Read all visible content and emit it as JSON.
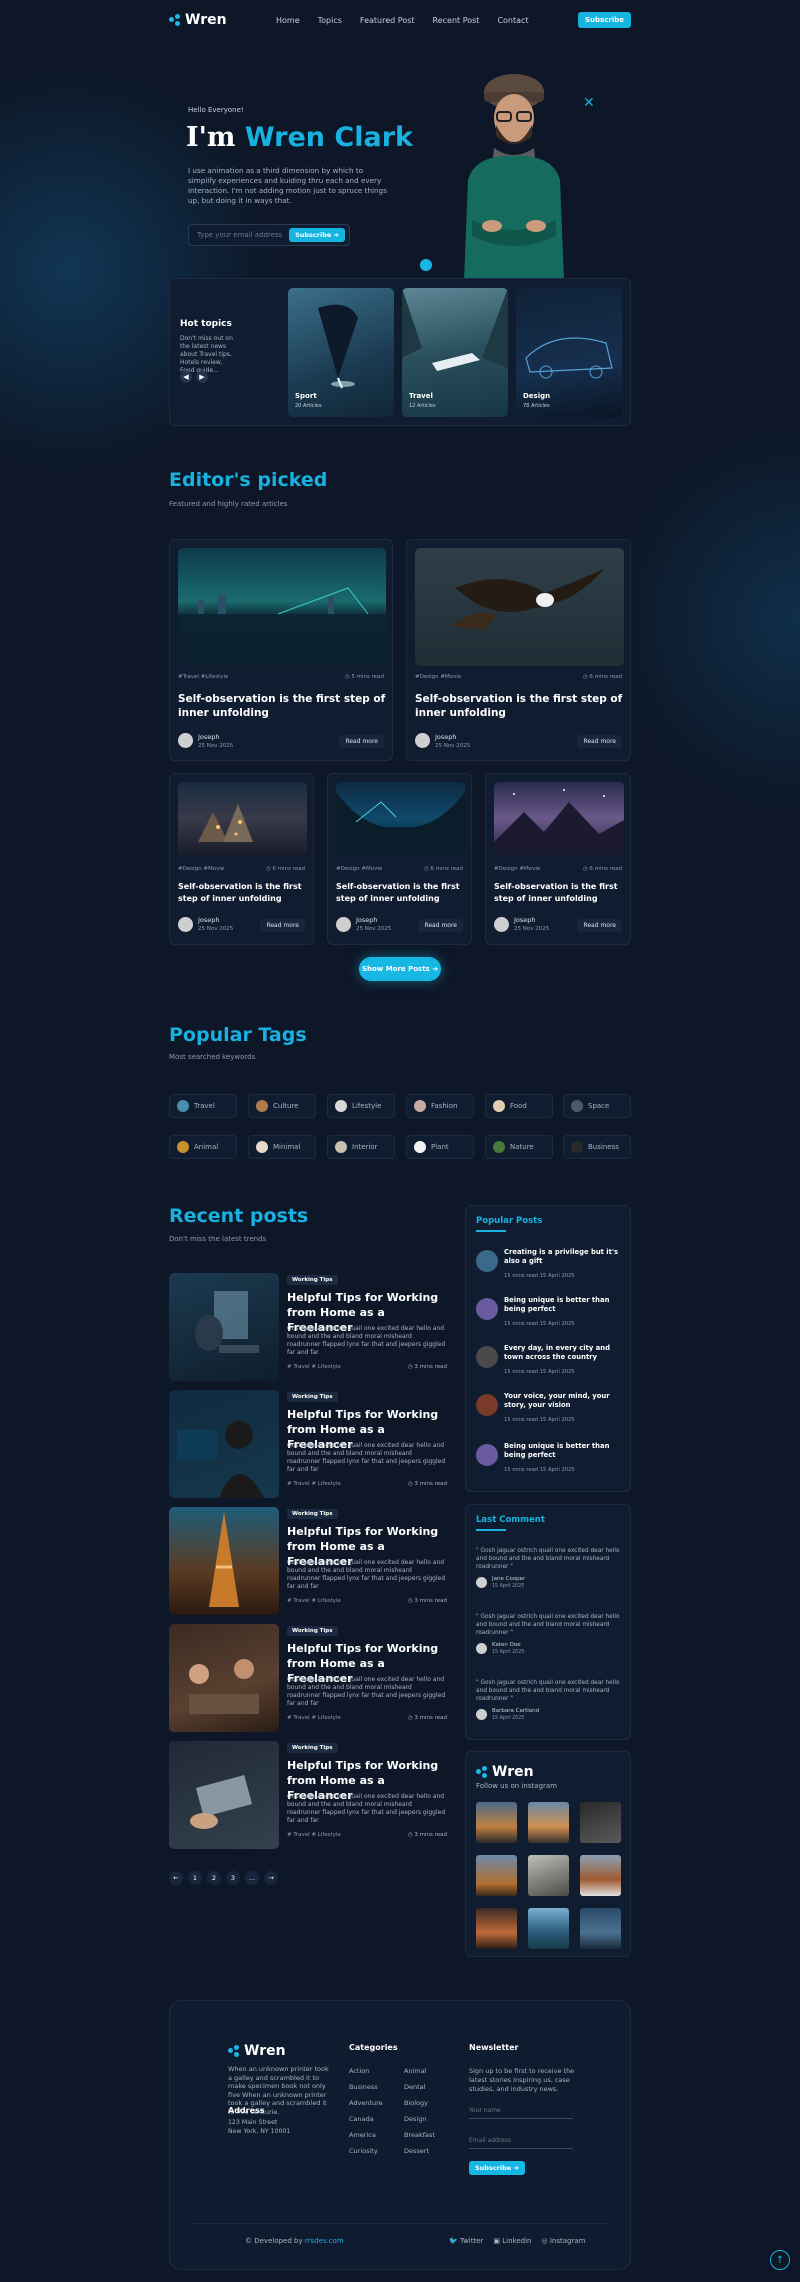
{
  "nav": {
    "brand": "Wren",
    "links": [
      "Home",
      "Topics",
      "Featured Post",
      "Recent Post",
      "Contact"
    ],
    "subscribe": "Subscribe"
  },
  "hero": {
    "hello": "Hello Everyone!",
    "title_prefix": "I'm",
    "title_name": "Wren Clark",
    "description": "I use animation as a third dimension by which to simplify experiences and kuiding thru each and every interaction. I'm not adding motion just to spruce things up, but doing it in ways that.",
    "email_placeholder": "Type your email address",
    "subscribe": "Subscribe"
  },
  "hot_topics": {
    "title": "Hot topics",
    "description": "Don't miss out on the latest news about Travel tips, Hotels review, Food guide...",
    "cards": [
      {
        "name": "Sport",
        "count": "20 Articles"
      },
      {
        "name": "Travel",
        "count": "12 Articles"
      },
      {
        "name": "Design",
        "count": "78 Articles"
      }
    ]
  },
  "editors": {
    "title": "Editor's picked",
    "subtitle": "Featured and highly rated articles",
    "cards": [
      {
        "tags": "#Travel #Lifestyle",
        "read": "5 mins read",
        "title": "Self-observation is the first step of inner unfolding",
        "author": "Joseph",
        "date": "25 Nov 2025",
        "cta": "Read more"
      },
      {
        "tags": "#Design #Movie",
        "read": "6 mins read",
        "title": "Self-observation is the first step of inner unfolding",
        "author": "Joseph",
        "date": "25 Nov 2025",
        "cta": "Read more"
      },
      {
        "tags": "#Design #Movie",
        "read": "6 mins read",
        "title": "Self-observation is the first step of inner unfolding",
        "author": "Joseph",
        "date": "25 Nov 2025",
        "cta": "Read more"
      },
      {
        "tags": "#Design #Movie",
        "read": "6 mins read",
        "title": "Self-observation is the first step of inner unfolding",
        "author": "Joseph",
        "date": "25 Nov 2025",
        "cta": "Read more"
      },
      {
        "tags": "#Design #Movie",
        "read": "6 mins read",
        "title": "Self-observation is the first step of inner unfolding",
        "author": "Joseph",
        "date": "25 Nov 2025",
        "cta": "Read more"
      }
    ],
    "show_more": "Show More Posts"
  },
  "tags": {
    "title": "Popular Tags",
    "subtitle": "Most searched keywords",
    "items": [
      "Travel",
      "Culture",
      "Lifestyle",
      "Fashion",
      "Food",
      "Space",
      "Animal",
      "Minimal",
      "Interior",
      "Plant",
      "Nature",
      "Business"
    ]
  },
  "recent": {
    "title": "Recent posts",
    "subtitle": "Don't miss the latest trends",
    "posts": [
      {
        "badge": "Working Tips",
        "title": "Helpful Tips for Working from Home as a Freelancer",
        "desc": "Gosh jaguar ostrich quail one excited dear hello and bound and the and bland moral misheard roadrunner flapped lynx far that and jeepers giggled far and far",
        "tags": "# Travel   # Lifestyle",
        "read": "3 mins read"
      },
      {
        "badge": "Working Tips",
        "title": "Helpful Tips for Working from Home as a Freelancer",
        "desc": "Gosh jaguar ostrich quail one excited dear hello and bound and the and bland moral misheard roadrunner flapped lynx far that and jeepers giggled far and far",
        "tags": "# Travel   # Lifestyle",
        "read": "3 mins read"
      },
      {
        "badge": "Working Tips",
        "title": "Helpful Tips for Working from Home as a Freelancer",
        "desc": "Gosh jaguar ostrich quail one excited dear hello and bound and the and bland moral misheard roadrunner flapped lynx far that and jeepers giggled far and far",
        "tags": "# Travel   # Lifestyle",
        "read": "3 mins read"
      },
      {
        "badge": "Working Tips",
        "title": "Helpful Tips for Working from Home as a Freelancer",
        "desc": "Gosh jaguar ostrich quail one excited dear hello and bound and the and bland moral misheard roadrunner flapped lynx far that and jeepers giggled far and far",
        "tags": "# Travel   # Lifestyle",
        "read": "3 mins read"
      },
      {
        "badge": "Working Tips",
        "title": "Helpful Tips for Working from Home as a Freelancer",
        "desc": "Gosh jaguar ostrich quail one excited dear hello and bound and the and bland moral misheard roadrunner flapped lynx far that and jeepers giggled far and far",
        "tags": "# Travel   # Lifestyle",
        "read": "3 mins read"
      }
    ],
    "pages": [
      "1",
      "2",
      "3",
      "..."
    ]
  },
  "popular": {
    "title": "Popular Posts",
    "items": [
      {
        "title": "Creating is a privilege but it's also a gift",
        "meta": "15 mins read   15 April 2025"
      },
      {
        "title": "Being unique is better than being perfect",
        "meta": "15 mins read   15 April 2025"
      },
      {
        "title": "Every day, in every city and town across the country",
        "meta": "15 mins read   15 April 2025"
      },
      {
        "title": "Your voice, your mind, your story, your vision",
        "meta": "15 mins read   15 April 2025"
      },
      {
        "title": "Being unique is better than being perfect",
        "meta": "15 mins read   15 April 2025"
      }
    ]
  },
  "comments": {
    "title": "Last Comment",
    "items": [
      {
        "text": "\" Gosh jaguar ostrich quail one excited dear hello and bound and the and bland moral misheard roadrunner \"",
        "name": "Jane Cooper",
        "date": "15 April 2025"
      },
      {
        "text": "\" Gosh jaguar ostrich quail one excited dear hello and bound and the and bland moral misheard roadrunner \"",
        "name": "Katen Doe",
        "date": "15 April 2025"
      },
      {
        "text": "\" Gosh jaguar ostrich quail one excited dear hello and bound and the and bland moral misheard roadrunner \"",
        "name": "Barbara Cartland",
        "date": "15 April 2025"
      }
    ]
  },
  "instagram": {
    "brand": "Wren",
    "follow": "Follow us on instagram"
  },
  "footer": {
    "brand": "Wren",
    "description": "When an unknown printer took a galley and scrambled it to make specimen book not only five When an unknown printer took a galley and scrambled it to five centurie.",
    "address_title": "Address",
    "address_line1": "123 Main Street",
    "address_line2": "New York, NY 10001",
    "categories_title": "Categories",
    "categories_col1": [
      "Action",
      "Business",
      "Adventure",
      "Canada",
      "America",
      "Curiosity"
    ],
    "categories_col2": [
      "Animal",
      "Dental",
      "Biology",
      "Design",
      "Breakfast",
      "Dessert"
    ],
    "newsletter_title": "Newsletter",
    "newsletter_desc": "Sign up to be first to receive the latest stories inspiring us, case studies, and industry news.",
    "name_placeholder": "Your name",
    "email_placeholder": "Email address",
    "subscribe": "Subscribe",
    "copyright_prefix": "© Developed by",
    "copyright_link": "rrsdev.com",
    "social": [
      "Twitter",
      "Linkedin",
      "Instagram"
    ]
  },
  "colors": {
    "accent": "#19b1e0",
    "background": "#0d1727",
    "card": "#101d31"
  },
  "icons": {
    "back_to_top": "arrow-up-icon",
    "prev": "arrow-left-icon",
    "next": "arrow-right-icon"
  }
}
